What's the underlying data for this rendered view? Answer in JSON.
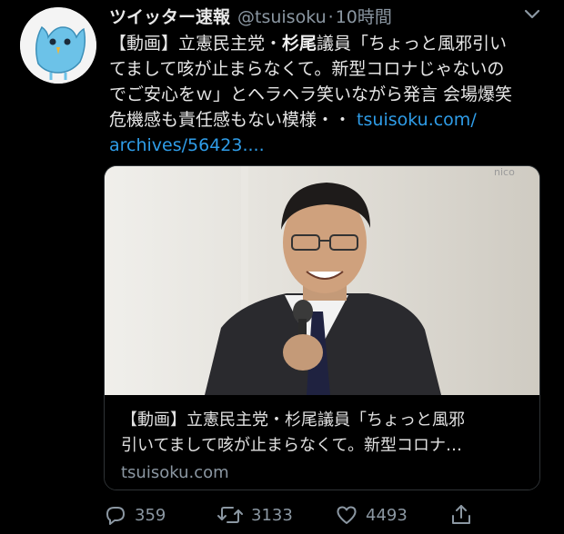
{
  "tweet": {
    "display_name": "ツイッター速報",
    "handle": "@tsuisoku",
    "separator": "·",
    "time": "10時間",
    "text_line1_pre": "【動画】立憲民主党・",
    "text_line1_bold": "杉尾",
    "text_line1_post": "議員「ちょっと風邪引い",
    "text_line2": "てまして咳が止まらなくて。新型コロナじゃないの",
    "text_line3": "でご安心をｗ」とヘラヘラ笑いながら発言 会場爆笑",
    "text_line4_pre": "危機感も責任感もない模様・・ ",
    "text_link1": "tsuisoku.com/",
    "text_link2": "archives/56423....",
    "card": {
      "title_line1": "【動画】立憲民主党・杉尾議員「ちょっと風邪",
      "title_line2": "引いてまして咳が止まらなくて。新型コロナ…",
      "domain": "tsuisoku.com",
      "watermark": "nico"
    },
    "actions": {
      "reply_count": "359",
      "retweet_count": "3133",
      "like_count": "4493"
    }
  },
  "icons": [
    "bird-avatar-icon",
    "chevron-down-icon",
    "reply-icon",
    "retweet-icon",
    "like-icon",
    "share-icon"
  ],
  "colors": {
    "background": "#000000",
    "link": "#2f9de8",
    "muted": "#8b97a2",
    "text": "#e6e6e6"
  }
}
